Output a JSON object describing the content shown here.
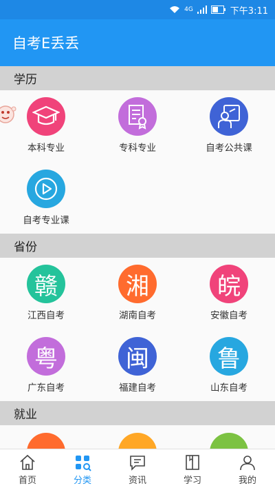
{
  "status_bar": {
    "network": "4G",
    "time": "下午3:11"
  },
  "app_bar": {
    "title": "自考E丢丢"
  },
  "sections": [
    {
      "title": "学历",
      "items": [
        {
          "label": "本科专业",
          "icon": "graduation-cap-icon",
          "color": "#f0437a"
        },
        {
          "label": "专科专业",
          "icon": "certificate-icon",
          "color": "#c26ddb"
        },
        {
          "label": "自考公共课",
          "icon": "blackboard-teacher-icon",
          "color": "#3f63d6"
        },
        {
          "label": "自考专业课",
          "icon": "play-icon",
          "color": "#27a7e0"
        }
      ]
    },
    {
      "title": "省份",
      "items": [
        {
          "label": "江西自考",
          "glyph": "赣",
          "color": "#24c39b"
        },
        {
          "label": "湖南自考",
          "glyph": "湘",
          "color": "#ff6b2e"
        },
        {
          "label": "安徽自考",
          "glyph": "皖",
          "color": "#f0437a"
        },
        {
          "label": "广东自考",
          "glyph": "粤",
          "color": "#c26ddb"
        },
        {
          "label": "福建自考",
          "glyph": "闽",
          "color": "#3f63d6"
        },
        {
          "label": "山东自考",
          "glyph": "鲁",
          "color": "#27a7e0"
        }
      ]
    },
    {
      "title": "就业",
      "items": [
        {
          "color": "#ff6b2e"
        },
        {
          "color": "#ffa726"
        },
        {
          "color": "#7cc242"
        }
      ]
    }
  ],
  "bottom_nav": [
    {
      "label": "首页",
      "icon": "home-icon"
    },
    {
      "label": "分类",
      "icon": "category-icon",
      "active": true
    },
    {
      "label": "资讯",
      "icon": "message-icon"
    },
    {
      "label": "学习",
      "icon": "book-icon"
    },
    {
      "label": "我的",
      "icon": "profile-icon"
    }
  ]
}
